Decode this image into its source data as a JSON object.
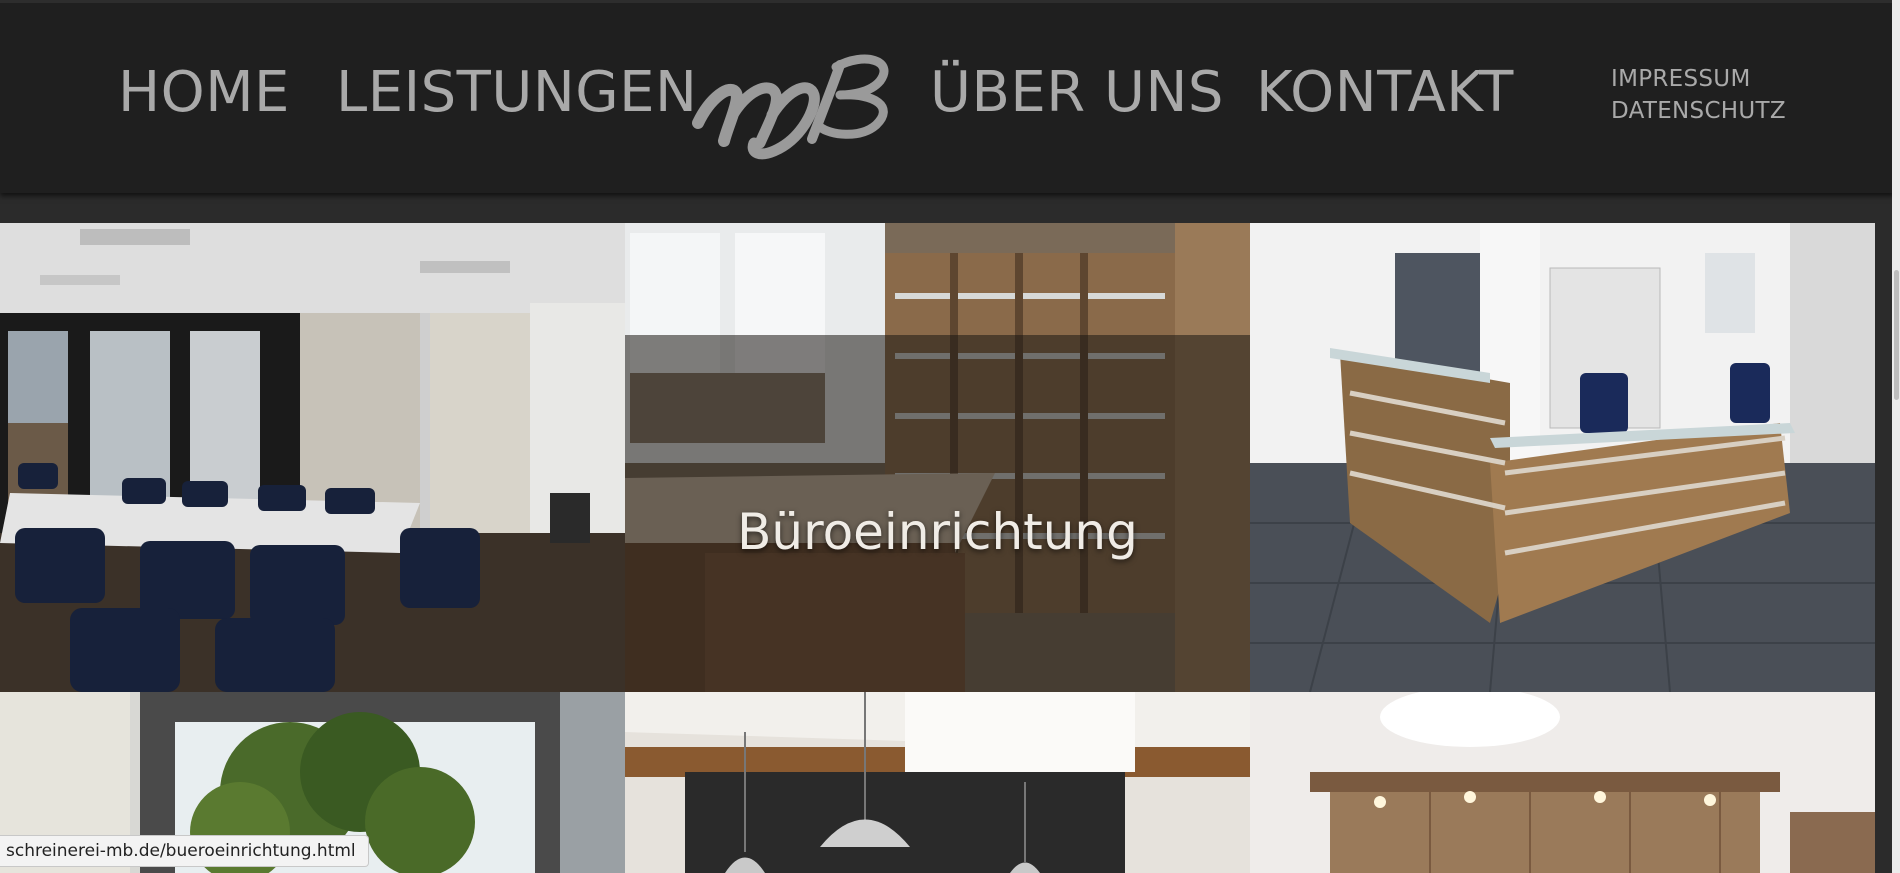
{
  "nav": {
    "home": "HOME",
    "leistungen": "LEISTUNGEN",
    "ueber_uns": "ÜBER UNS",
    "kontakt": "KONTAKT",
    "impressum": "IMPRESSUM",
    "datenschutz": "DATENSCHUTZ"
  },
  "logo": {
    "text": "MB",
    "icon": "mb-logo"
  },
  "gallery": {
    "hover_label": "Büroeinrichtung",
    "tiles": [
      "conference-room",
      "office-shelving",
      "reception-desk",
      "plant-window",
      "pendant-lamps",
      "cabinet-wall"
    ]
  },
  "status_bar": {
    "url": "schreinerei-mb.de/bueroeinrichtung.html"
  },
  "colors": {
    "header_bg": "#1f1f1f",
    "nav_text": "#a9a9a9",
    "page_bg": "#2b2b2b"
  }
}
